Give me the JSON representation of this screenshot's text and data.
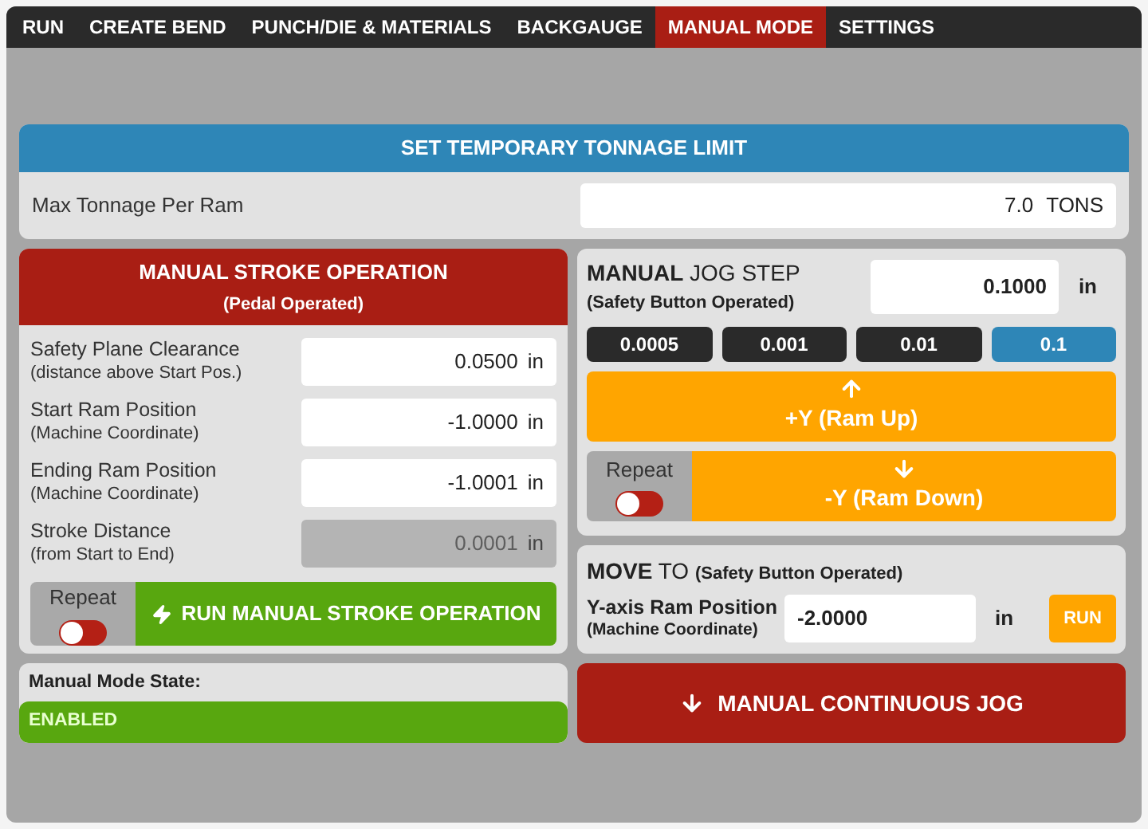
{
  "tabs": [
    {
      "label": "RUN",
      "selected": false
    },
    {
      "label": "CREATE BEND",
      "selected": false
    },
    {
      "label": "PUNCH/DIE & MATERIALS",
      "selected": false
    },
    {
      "label": "BACKGAUGE",
      "selected": false
    },
    {
      "label": "MANUAL MODE",
      "selected": true
    },
    {
      "label": "SETTINGS",
      "selected": false
    }
  ],
  "tonnage": {
    "title": "SET TEMPORARY TONNAGE LIMIT",
    "label": "Max Tonnage Per Ram",
    "value": "7.0",
    "unit": "TONS"
  },
  "stroke": {
    "title": "MANUAL STROKE OPERATION",
    "subtitle": "(Pedal Operated)",
    "fields": [
      {
        "label": "Safety Plane Clearance",
        "sublabel": "(distance above Start Pos.)",
        "value": "0.0500",
        "unit": "in",
        "disabled": false
      },
      {
        "label": "Start Ram Position",
        "sublabel": "(Machine Coordinate)",
        "value": "-1.0000",
        "unit": "in",
        "disabled": false
      },
      {
        "label": "Ending Ram Position",
        "sublabel": "(Machine Coordinate)",
        "value": "-1.0001",
        "unit": "in",
        "disabled": false
      },
      {
        "label": "Stroke Distance",
        "sublabel": "(from Start to End)",
        "value": "0.0001",
        "unit": "in",
        "disabled": true
      }
    ],
    "repeat": {
      "label": "Repeat",
      "on": false
    },
    "run_button": "RUN MANUAL STROKE OPERATION"
  },
  "jog": {
    "title_bold": "MANUAL",
    "title_rest": "JOG STEP",
    "subtitle": "(Safety Button Operated)",
    "value": "0.1000",
    "unit": "in",
    "steps": [
      {
        "label": "0.0005",
        "selected": false
      },
      {
        "label": "0.001",
        "selected": false
      },
      {
        "label": "0.01",
        "selected": false
      },
      {
        "label": "0.1",
        "selected": true
      }
    ],
    "up_button": "+Y (Ram Up)",
    "down_button": "-Y (Ram Down)",
    "repeat": {
      "label": "Repeat",
      "on": false
    }
  },
  "move_to": {
    "title_bold": "MOVE",
    "title_rest": "TO",
    "subtitle": "(Safety Button Operated)",
    "label": "Y-axis Ram Position",
    "sublabel": "(Machine Coordinate)",
    "value": "-2.0000",
    "unit": "in",
    "run_button": "RUN"
  },
  "state": {
    "label": "Manual Mode State:",
    "value": "ENABLED"
  },
  "continuous_jog": "MANUAL CONTINUOUS JOG"
}
